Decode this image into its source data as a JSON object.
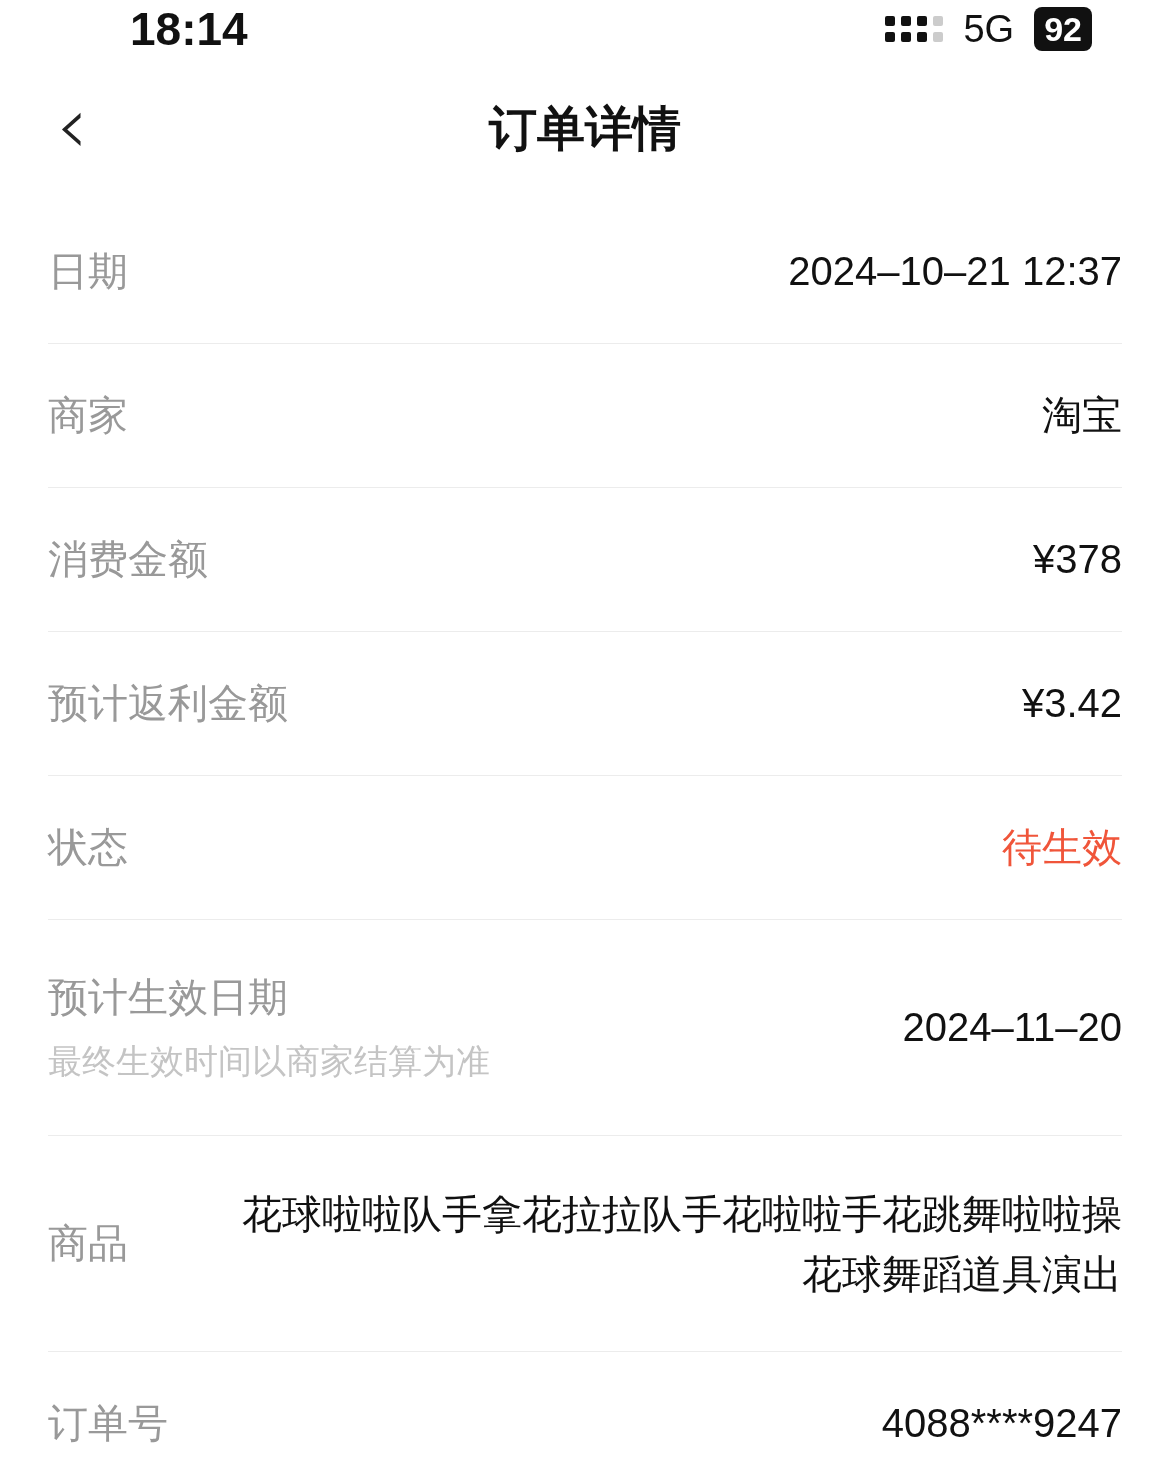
{
  "status_bar": {
    "time": "18:14",
    "network": "5G",
    "battery": "92"
  },
  "header": {
    "back": "‹",
    "title": "订单详情"
  },
  "rows": [
    {
      "label": "日期",
      "value": "2024–10–21 12:37",
      "kind": "plain"
    },
    {
      "label": "商家",
      "value": "淘宝",
      "kind": "plain"
    },
    {
      "label": "消费金额",
      "value": "¥378",
      "kind": "plain"
    },
    {
      "label": "预计返利金额",
      "value": "¥3.42",
      "kind": "plain"
    },
    {
      "label": "状态",
      "value": "待生效",
      "kind": "status"
    },
    {
      "label": "预计生效日期",
      "note": "最终生效时间以商家结算为准",
      "value": "2024–11–20",
      "kind": "plain"
    },
    {
      "label": "商品",
      "value": "花球啦啦队手拿花拉拉队手花啦啦手花跳舞啦啦操花球舞蹈道具演出",
      "kind": "long"
    },
    {
      "label": "订单号",
      "value": "4088****9247",
      "kind": "plain"
    }
  ]
}
